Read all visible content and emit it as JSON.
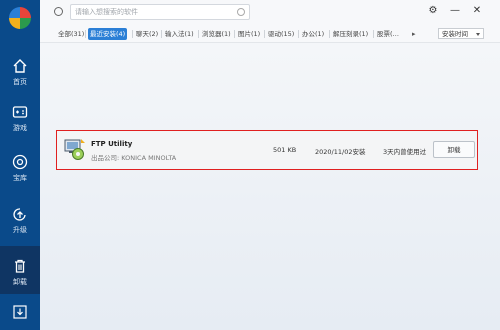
{
  "sidebar": {
    "items": [
      {
        "label": "首页",
        "icon": "home-icon"
      },
      {
        "label": "游戏",
        "icon": "gamepad-icon"
      },
      {
        "label": "宝库",
        "icon": "treasure-icon"
      },
      {
        "label": "升级",
        "icon": "upgrade-icon"
      },
      {
        "label": "卸载",
        "icon": "trash-icon",
        "active": true
      }
    ]
  },
  "search": {
    "placeholder": "请输入想搜索的软件"
  },
  "tabs": [
    {
      "label": "全部(31)"
    },
    {
      "label": "最近安装(4)",
      "active": true
    },
    {
      "label": "聊天(2)"
    },
    {
      "label": "输入法(1)"
    },
    {
      "label": "浏览器(1)"
    },
    {
      "label": "图片(1)"
    },
    {
      "label": "驱动(15)"
    },
    {
      "label": "办公(1)"
    },
    {
      "label": "解压刻录(1)"
    },
    {
      "label": "股票(…"
    }
  ],
  "sort": {
    "selected": "安装时间"
  },
  "apps": [
    {
      "name": "FTP Utility",
      "publisher": "出品公司: KONICA MINOLTA",
      "size": "501 KB",
      "install_date": "2020/11/02安装",
      "usage": "3天内曾使用过",
      "action": "卸载"
    }
  ],
  "colors": {
    "sidebar": "#0a4a8a",
    "accent": "#2b7fd6",
    "highlight_border": "#e02020"
  }
}
